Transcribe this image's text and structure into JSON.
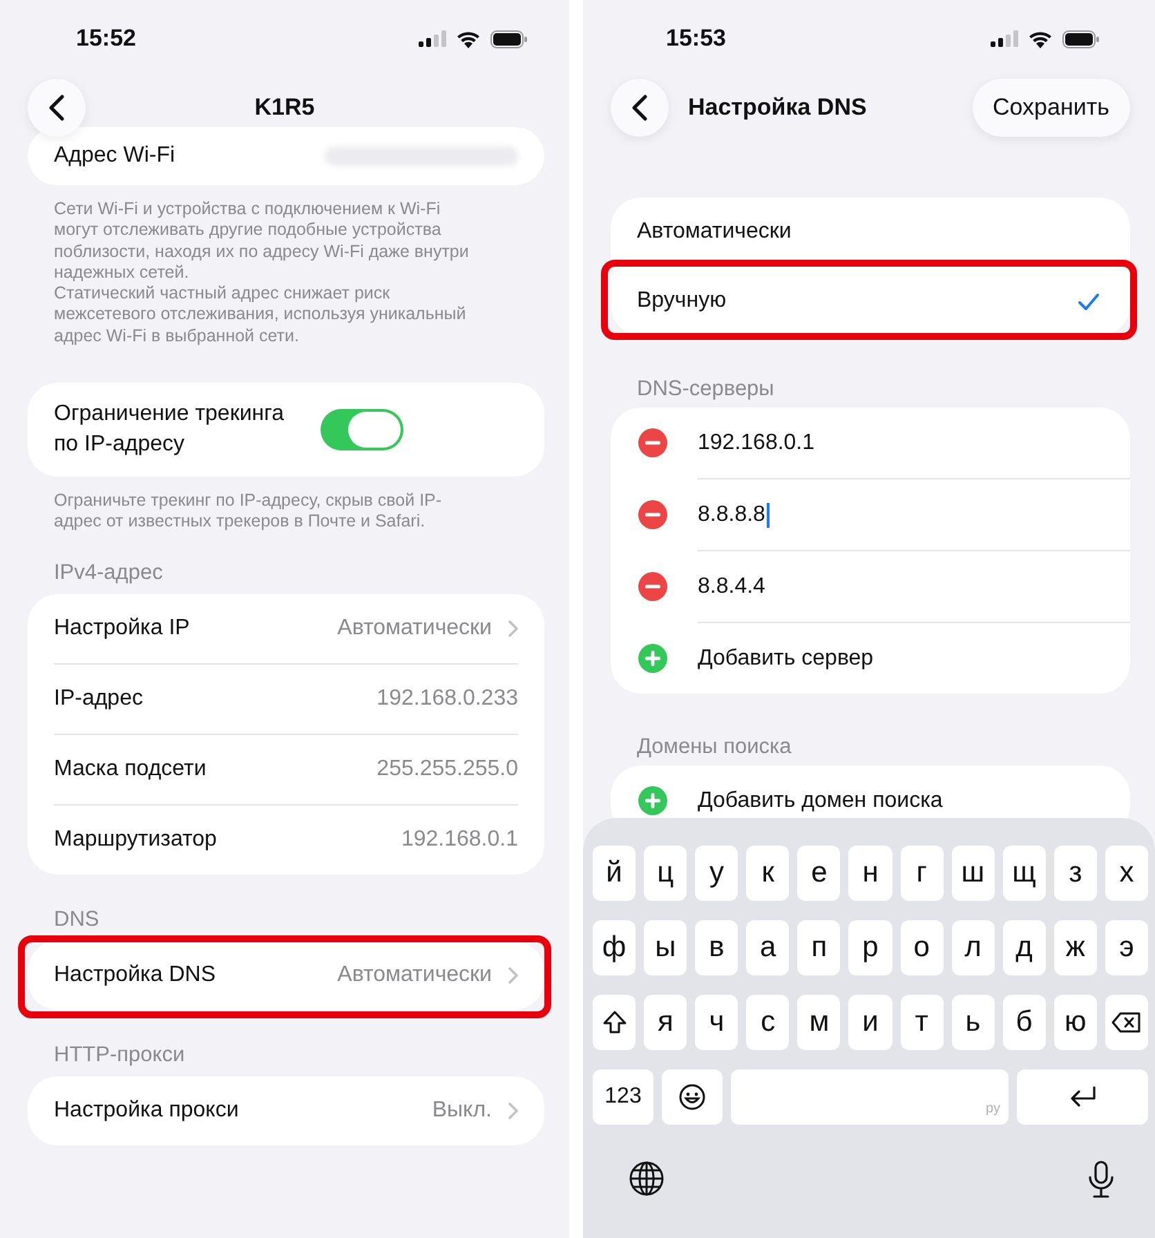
{
  "left": {
    "status_bar": {
      "time": "15:52"
    },
    "nav": {
      "title": "K1R5"
    },
    "groups": [
      {
        "rows": [
          {
            "kind": "redacted",
            "label": "Адрес Wi-Fi",
            "highlighted": false
          }
        ],
        "footer": [
          "Сети Wi-Fi и устройства с подключением к Wi-Fi могут отслеживать другие подобные устройства поблизости, находя их по адресу Wi-Fi даже внутри надежных сетей.",
          "Статический частный адрес снижает риск межсетевого отслеживания, используя уникальный адрес Wi-Fi в выбранной сети."
        ]
      },
      {
        "rows": [
          {
            "kind": "toggle",
            "label": "Ограничение трекинга по IP-адресу",
            "on": true,
            "highlighted": false
          }
        ],
        "footer": [
          "Ограничьте трекинг по IP-адресу, скрыв свой IP-адрес от известных трекеров в Почте и Safari."
        ]
      },
      {
        "header": "IPv4-адрес",
        "rows": [
          {
            "kind": "value",
            "label": "Настройка IP",
            "value": "Автоматически",
            "chevron": true,
            "highlighted": false
          },
          {
            "kind": "value",
            "label": "IP-адрес",
            "value": "192.168.0.233",
            "chevron": false,
            "highlighted": false
          },
          {
            "kind": "value",
            "label": "Маска подсети",
            "value": "255.255.255.0",
            "chevron": false,
            "highlighted": false
          },
          {
            "kind": "value",
            "label": "Маршрутизатор",
            "value": "192.168.0.1",
            "chevron": false,
            "highlighted": false
          }
        ]
      },
      {
        "header": "DNS",
        "rows": [
          {
            "kind": "value",
            "label": "Настройка DNS",
            "value": "Автоматически",
            "chevron": true,
            "highlighted": true
          }
        ]
      },
      {
        "header": "HTTP-прокси",
        "rows": [
          {
            "kind": "value",
            "label": "Настройка прокси",
            "value": "Выкл.",
            "chevron": true,
            "highlighted": false
          }
        ]
      }
    ]
  },
  "right": {
    "status_bar": {
      "time": "15:53"
    },
    "nav": {
      "title": "Настройка DNS",
      "action": "Сохранить"
    },
    "mode_options": [
      {
        "label": "Автоматически",
        "selected": false,
        "highlighted": false
      },
      {
        "label": "Вручную",
        "selected": true,
        "highlighted": true
      }
    ],
    "dns_servers": {
      "header": "DNS-серверы",
      "items": [
        {
          "kind": "remove",
          "label": "192.168.0.1",
          "focused": false
        },
        {
          "kind": "remove",
          "label": "8.8.8.8",
          "focused": true
        },
        {
          "kind": "remove",
          "label": "8.8.4.4",
          "focused": false
        },
        {
          "kind": "add",
          "label": "Добавить сервер",
          "focused": false
        }
      ]
    },
    "search_domains": {
      "header": "Домены поиска",
      "items": [
        {
          "kind": "add",
          "label": "Добавить домен поиска",
          "focused": false
        }
      ]
    },
    "keyboard": {
      "rows": [
        {
          "kind": "letters",
          "keys": [
            "й",
            "ц",
            "у",
            "к",
            "е",
            "н",
            "г",
            "ш",
            "щ",
            "з",
            "х"
          ]
        },
        {
          "kind": "letters",
          "keys": [
            "ф",
            "ы",
            "в",
            "а",
            "п",
            "р",
            "о",
            "л",
            "д",
            "ж",
            "э"
          ]
        },
        {
          "kind": "shift",
          "keys": [
            "я",
            "ч",
            "с",
            "м",
            "и",
            "т",
            "ь",
            "б",
            "ю"
          ]
        }
      ],
      "numbers_key": "123",
      "space_label": "ру"
    }
  }
}
